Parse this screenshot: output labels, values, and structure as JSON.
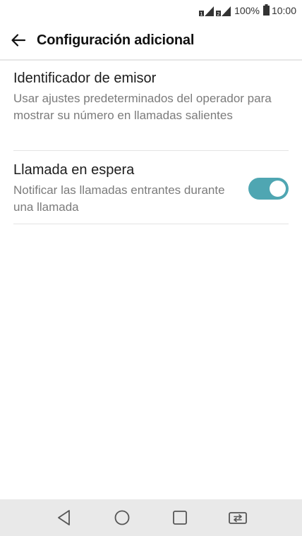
{
  "status_bar": {
    "battery_percent": "100%",
    "time": "10:00",
    "icons": [
      "sim1-signal-icon",
      "sim2-signal-icon",
      "battery-icon"
    ]
  },
  "app_bar": {
    "title": "Configuración adicional",
    "back_icon": "back-arrow-icon"
  },
  "settings": {
    "caller_id": {
      "title": "Identificador de emisor",
      "subtitle": "Usar ajustes predeterminados del operador para mostrar su número en llamadas salientes"
    },
    "call_waiting": {
      "title": "Llamada en espera",
      "subtitle": "Notificar las llamadas entrantes durante una llamada",
      "enabled": true
    }
  },
  "nav_bar": {
    "buttons": [
      "back-triangle-icon",
      "home-circle-icon",
      "recents-square-icon",
      "dual-window-icon"
    ]
  },
  "colors": {
    "toggle_on": "#4fa6b2",
    "nav_background": "#e9e9e9",
    "divider": "#e3e3e3"
  }
}
